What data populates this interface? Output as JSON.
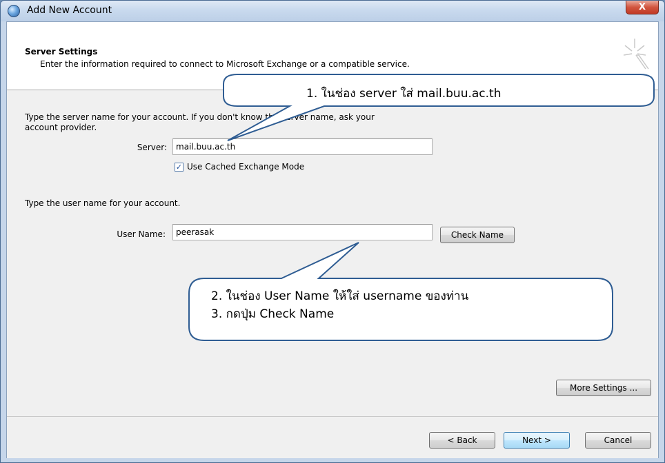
{
  "window": {
    "title": "Add New Account",
    "close_glyph": "X"
  },
  "header": {
    "title": "Server Settings",
    "subtitle": "Enter the information required to connect to Microsoft Exchange or a compatible service."
  },
  "server_section": {
    "instruction": "Type the server name for your account. If you don't know the server name, ask your",
    "instruction_line2": "account provider.",
    "server_label": "Server:",
    "server_value": "mail.buu.ac.th",
    "cached_mode_label": "Use Cached Exchange Mode",
    "cached_mode_checked": true
  },
  "user_section": {
    "instruction": "Type the user name for your account.",
    "username_label": "User Name:",
    "username_value": "peerasak",
    "check_name_button": "Check Name"
  },
  "buttons": {
    "more_settings": "More Settings ...",
    "back": "< Back",
    "next": "Next >",
    "cancel": "Cancel"
  },
  "callouts": {
    "callout1": "1. ในช่อง server ใส่ mail.buu.ac.th",
    "callout2_line1": "2. ในช่อง User Name ให้ใส่ username ของท่าน",
    "callout2_line2": "3. กดปุ่ม Check Name"
  },
  "colors": {
    "callout_border": "#2f5d93",
    "default_button_border": "#3c7fb1",
    "close_button": "#c9432e"
  }
}
